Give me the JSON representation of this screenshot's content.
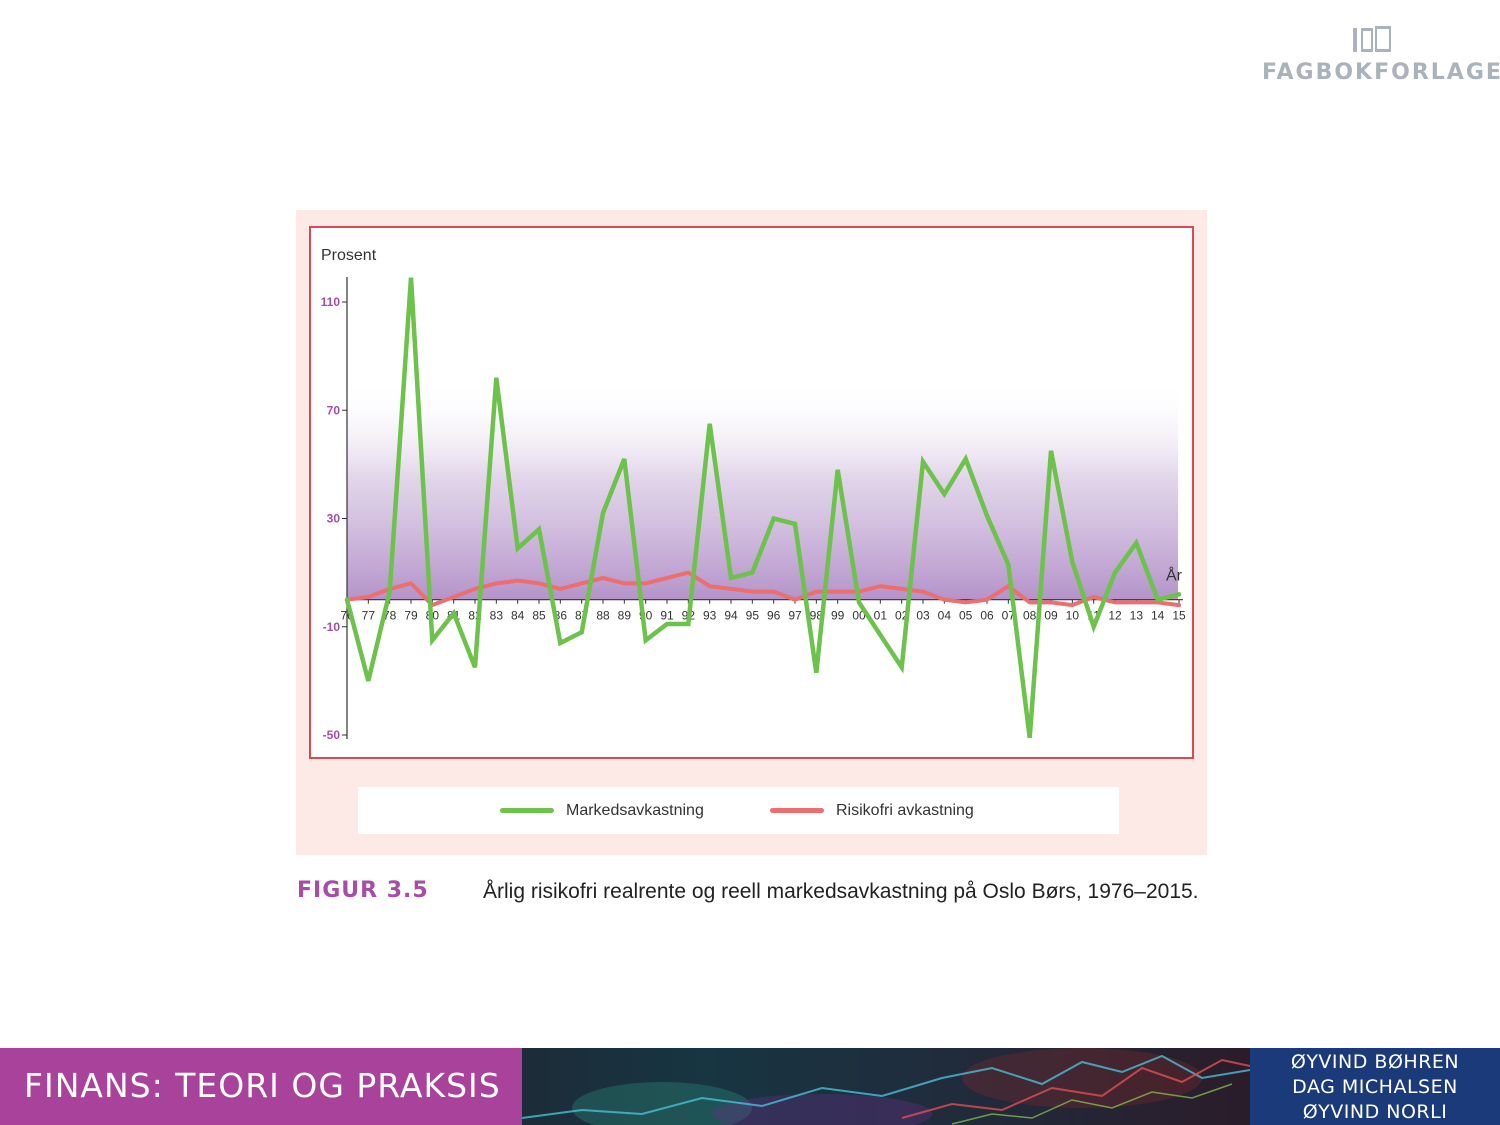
{
  "brand": {
    "name": "FAGBOKFORLAGET",
    "logo_icon": "book-logo-icon"
  },
  "caption": {
    "label": "FIGUR 3.5",
    "text": "Årlig risikofri realrente og reell markedsavkastning på Oslo Børs, 1976–2015."
  },
  "footer": {
    "title": "FINANS: TEORI OG PRAKSIS",
    "authors": [
      "ØYVIND BØHREN",
      "DAG MICHALSEN",
      "ØYVIND NORLI"
    ]
  },
  "colors": {
    "market": "#6cc24a",
    "riskfree": "#ec6e6e",
    "frame": "#d94a55",
    "tick_label": "#a64da6",
    "accent": "#a8429a"
  },
  "chart_data": {
    "type": "line",
    "ylabel": "Prosent",
    "xlabel": "År",
    "ylim": [
      -50,
      120
    ],
    "yticks": [
      110,
      70,
      30,
      -10,
      -50
    ],
    "categories": [
      "76",
      "77",
      "78",
      "79",
      "80",
      "81",
      "82",
      "83",
      "84",
      "85",
      "86",
      "87",
      "88",
      "89",
      "90",
      "91",
      "92",
      "93",
      "94",
      "95",
      "96",
      "97",
      "98",
      "99",
      "00",
      "01",
      "02",
      "03",
      "04",
      "05",
      "06",
      "07",
      "08",
      "09",
      "10",
      "11",
      "12",
      "13",
      "14",
      "15"
    ],
    "series": [
      {
        "name": "Markedsavkastning",
        "values": [
          0,
          -30,
          3,
          119,
          -15,
          -5,
          -25,
          82,
          19,
          26,
          -16,
          -12,
          32,
          52,
          -15,
          -9,
          -9,
          65,
          8,
          10,
          30,
          28,
          -27,
          48,
          -1,
          -13,
          -25,
          51,
          39,
          52,
          31,
          13,
          -51,
          55,
          14,
          -10,
          10,
          21,
          0,
          2
        ]
      },
      {
        "name": "Risikofri avkastning",
        "values": [
          0,
          1,
          4,
          6,
          -2,
          1,
          4,
          6,
          7,
          6,
          4,
          6,
          8,
          6,
          6,
          8,
          10,
          5,
          4,
          3,
          3,
          0,
          3,
          3,
          3,
          5,
          4,
          3,
          0,
          -1,
          0,
          5,
          -1,
          -1,
          -2,
          1,
          -1,
          -1,
          -1,
          -2
        ]
      }
    ]
  }
}
